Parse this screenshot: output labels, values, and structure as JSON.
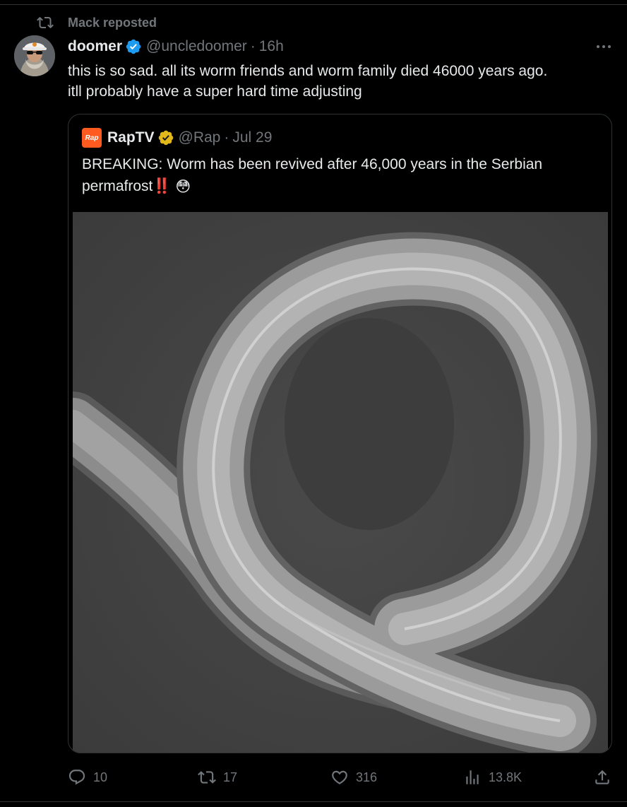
{
  "repost_banner": {
    "text": "Mack reposted"
  },
  "post": {
    "author_name": "doomer",
    "handle": "@uncledoomer",
    "separator": "·",
    "time": "16h",
    "lines": [
      "this is so sad. all its worm friends and worm family died 46000 years ago.",
      "itll probably have a super hard time adjusting"
    ]
  },
  "quote": {
    "logo_text": "Rap",
    "author_name": "RapTV",
    "handle": "@Rap",
    "separator": "·",
    "time": "Jul 29",
    "line1": "BREAKING: Worm has been revived after 46,000 years in the Serbian",
    "line2": "permafrost",
    "line2_marks": "‼️",
    "line2_emoji": "😳"
  },
  "actions": {
    "replies": "10",
    "reposts": "17",
    "likes": "316",
    "views": "13.8K"
  },
  "icons": {
    "repost": "repost-icon",
    "verified_blue": "verified-badge-icon",
    "verified_gold": "gold-verified-badge-icon",
    "more": "more-icon",
    "reply": "reply-icon",
    "like": "heart-icon",
    "views": "analytics-icon",
    "share": "share-icon"
  },
  "colors": {
    "background": "#000000",
    "text": "#e7e9ea",
    "muted": "#71767b",
    "border": "#2f3336",
    "verified_blue": "#1d9bf0",
    "verified_gold": "#e2b719",
    "raptv_orange": "#ff5a1f"
  }
}
